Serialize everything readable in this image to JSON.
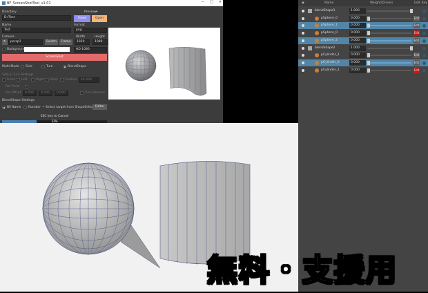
{
  "window": {
    "title": "BF_ScreenShotTool_v1.01"
  },
  "form": {
    "directory_label": "Directory",
    "directory_value": "D:/Test",
    "preview_label": "Preview",
    "preview_button": "Fixed",
    "open_button": "Open",
    "name_label": "Name",
    "name_value": "Test",
    "format_label": "Format",
    "format_value": "png",
    "camera_label": "Camera",
    "camera_value": "persp1",
    "switch_button": "Switch",
    "frame_button": "Frame",
    "width_label": "Width",
    "width_value": "1920",
    "height_label": "Height",
    "height_value": "1080",
    "background_label": "Background",
    "resolution_value": "HD 1080",
    "screenshot_button": "ScreenShot",
    "multi_mode_label": "Multi Mode",
    "mode_side": "Side",
    "mode_turn": "Turn",
    "mode_blendshape": "BlendShape",
    "side_turn_settings": "Side & Turn Settings",
    "front": "Front",
    "left": "Left",
    "right": "Right",
    "back": "Back",
    "custom": "Custom",
    "custom_value": "45.000",
    "rot_pivot": "Rot Pivot",
    "rot_offset": "Rot Offset",
    "rot_offset_values": [
      "0.000",
      "0.000",
      "0.000"
    ],
    "turn_reverse": "Turn Reverse",
    "blendshape_settings": "BlendShape Settings",
    "bs_name": "BS Name",
    "number": "Number",
    "select_target": "Select target from ShapeEditor",
    "editor_button": "Editor",
    "esc_hint": "ESC key to Cancel",
    "progress_text": "33%",
    "progress_fraction": 0.33
  },
  "list": {
    "header_name": "Name",
    "header_weight": "Weight/Drivers",
    "header_edit": "Edit",
    "header_key": "Key",
    "rows": [
      {
        "name": "blendShape1",
        "value": "1.000",
        "type": "group",
        "selected": false,
        "edit": "",
        "weight": 1.0
      },
      {
        "name": "pSphere_0",
        "value": "0.000",
        "type": "target",
        "selected": false,
        "edit": "Edit",
        "red": false,
        "weight": 0.0
      },
      {
        "name": "pSphere_1",
        "value": "0.000",
        "type": "target",
        "selected": true,
        "edit": "Edit",
        "red": false,
        "weight": 0.0
      },
      {
        "name": "pSphere_0",
        "value": "0.000",
        "type": "target",
        "selected": false,
        "edit": "Edit",
        "red": true,
        "weight": 0.0
      },
      {
        "name": "pSphere_2",
        "value": "0.000",
        "type": "target",
        "selected": true,
        "edit": "Edit",
        "red": false,
        "weight": 0.0
      },
      {
        "name": "blendShape2",
        "value": "1.000",
        "type": "group",
        "selected": false,
        "edit": "",
        "weight": 1.0
      },
      {
        "name": "pCylinder_1",
        "value": "0.000",
        "type": "target",
        "selected": false,
        "edit": "Edit",
        "red": false,
        "weight": 0.0
      },
      {
        "name": "pCylinder_0",
        "value": "0.000",
        "type": "target",
        "selected": true,
        "edit": "Edit",
        "red": false,
        "weight": 0.0
      },
      {
        "name": "pCylinder_2",
        "value": "0.000",
        "type": "target",
        "selected": false,
        "edit": "Edit",
        "red": true,
        "weight": 0.0
      }
    ]
  },
  "overlay": {
    "text": "無料・支援用"
  },
  "colors": {
    "preview_button": "#8f8fef",
    "open_button": "#f3b67a",
    "screenshot_button": "#e26a6a",
    "selected_row": "#5285a6",
    "edit_red": "#c41b1b"
  }
}
